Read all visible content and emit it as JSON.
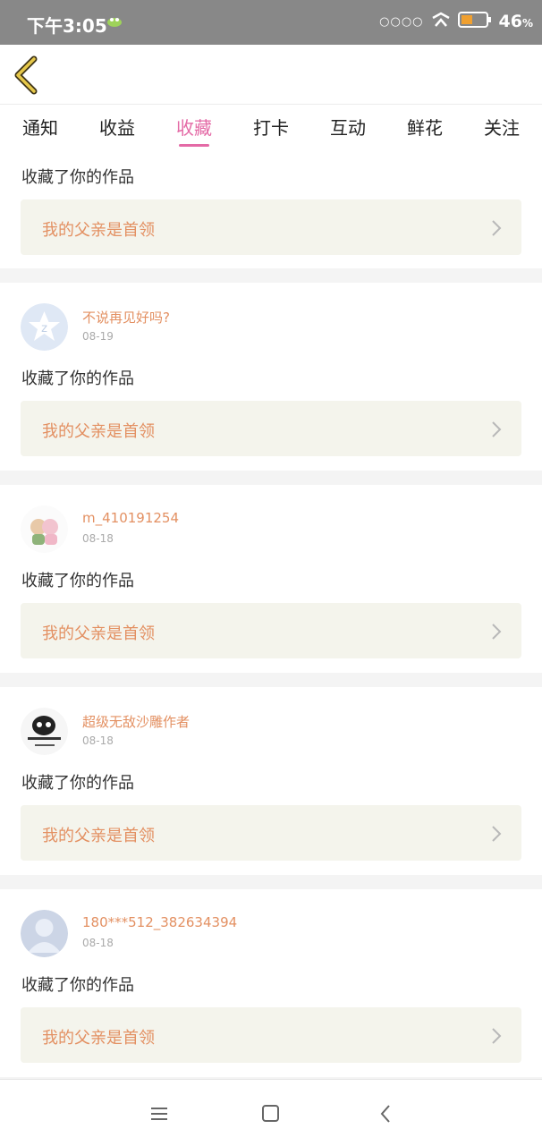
{
  "status_bar": {
    "time": "下午3:05",
    "signal_dots": "○○○○",
    "battery_percent": "46",
    "battery_unit": "%",
    "battery_level": 0.46
  },
  "tabs": [
    {
      "label": "通知"
    },
    {
      "label": "收益"
    },
    {
      "label": "收藏"
    },
    {
      "label": "打卡"
    },
    {
      "label": "互动"
    },
    {
      "label": "鲜花"
    },
    {
      "label": "关注"
    }
  ],
  "active_tab": "收藏",
  "notifications": [
    {
      "action": "收藏了你的作品",
      "work_title": "我的父亲是首领"
    },
    {
      "username": "不说再见好吗?",
      "date": "08-19",
      "action": "收藏了你的作品",
      "work_title": "我的父亲是首领"
    },
    {
      "username": "m_410191254",
      "date": "08-18",
      "action": "收藏了你的作品",
      "work_title": "我的父亲是首领"
    },
    {
      "username": "超级无敌沙雕作者",
      "date": "08-18",
      "action": "收藏了你的作品",
      "work_title": "我的父亲是首领"
    },
    {
      "username": "180***512_382634394",
      "date": "08-18",
      "action": "收藏了你的作品",
      "work_title": "我的父亲是首领"
    }
  ],
  "colors": {
    "accent": "#e46aa6",
    "username": "#e39062",
    "work_box_bg": "#f4f4ec"
  }
}
